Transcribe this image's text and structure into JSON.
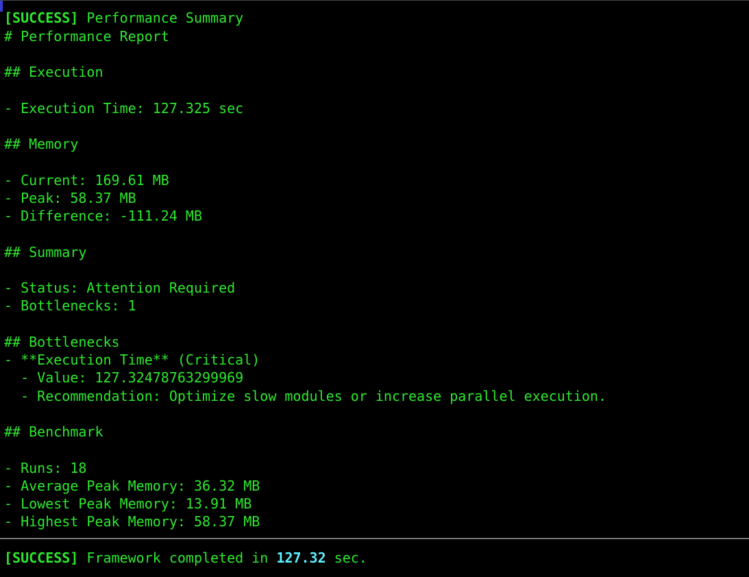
{
  "header": {
    "tag": "[SUCCESS]",
    "title": " Performance Summary"
  },
  "report": {
    "title": "# Performance Report",
    "execution": {
      "heading": "## Execution",
      "time": "- Execution Time: 127.325 sec"
    },
    "memory": {
      "heading": "## Memory",
      "current": "- Current: 169.61 MB",
      "peak": "- Peak: 58.37 MB",
      "difference": "- Difference: -111.24 MB"
    },
    "summary": {
      "heading": "## Summary",
      "status": "- Status: Attention Required",
      "bottlenecks": "- Bottlenecks: 1"
    },
    "bottlenecks": {
      "heading": "## Bottlenecks",
      "item": "- **Execution Time** (Critical)",
      "value": "  - Value: 127.32478763299969",
      "recommendation": "  - Recommendation: Optimize slow modules or increase parallel execution."
    },
    "benchmark": {
      "heading": "## Benchmark",
      "runs": "- Runs: 18",
      "average": "- Average Peak Memory: 36.32 MB",
      "lowest": "- Lowest Peak Memory: 13.91 MB",
      "highest": "- Highest Peak Memory: 58.37 MB"
    }
  },
  "footer": {
    "tag": "[SUCCESS]",
    "prefix": " Framework completed in ",
    "seconds": "127.32",
    "suffix": " sec."
  }
}
